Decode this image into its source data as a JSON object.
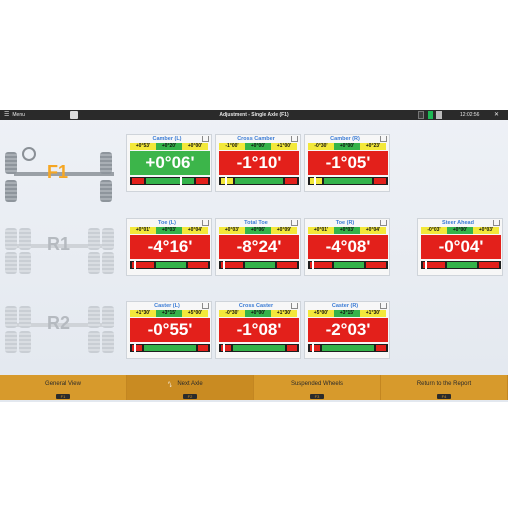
{
  "topbar": {
    "menu_label": "Menu",
    "title": "Adjustment - Single Axle (F1)",
    "time": "12:02:56"
  },
  "axles": {
    "f1": "F1",
    "r1": "R1",
    "r2": "R2"
  },
  "cards": {
    "camber_l": {
      "title": "Camber (L)",
      "tol": [
        "+0°53'",
        "+0°20'",
        "+0°00'"
      ],
      "value": "+0°06'"
    },
    "cross_camber": {
      "title": "Cross Camber",
      "tol": [
        "-1°00'",
        "+0°00'",
        "+1°00'"
      ],
      "value": "-1°10'"
    },
    "camber_r": {
      "title": "Camber (R)",
      "tol": [
        "-0°30'",
        "+0°00'",
        "+0°23'"
      ],
      "value": "-1°05'"
    },
    "toe_l": {
      "title": "Toe (L)",
      "tol": [
        "+0°01'",
        "+0°03'",
        "+0°04'"
      ],
      "value": "-4°16'"
    },
    "total_toe": {
      "title": "Total Toe",
      "tol": [
        "+0°03'",
        "+0°06'",
        "+0°09'"
      ],
      "value": "-8°24'"
    },
    "toe_r": {
      "title": "Toe (R)",
      "tol": [
        "+0°01'",
        "+0°03'",
        "+0°04'"
      ],
      "value": "-4°08'"
    },
    "steer_ahead": {
      "title": "Steer Ahead",
      "tol": [
        "-0°03'",
        "+0°00'",
        "+0°03'"
      ],
      "value": "-0°04'"
    },
    "caster_l": {
      "title": "Caster (L)",
      "tol": [
        "+1°30'",
        "+3°15'",
        "+5°00'"
      ],
      "value": "-0°55'"
    },
    "cross_caster": {
      "title": "Cross Caster",
      "tol": [
        "-0°30'",
        "+0°00'",
        "+1°30'"
      ],
      "value": "-1°08'"
    },
    "caster_r": {
      "title": "Caster (R)",
      "tol": [
        "+5°00'",
        "+3°15'",
        "+1°30'"
      ],
      "value": "-2°03'"
    }
  },
  "fnbar": {
    "b1": {
      "label": "General View",
      "key": "F1"
    },
    "b2": {
      "label": "Next Axle",
      "key": "F2"
    },
    "b3": {
      "label": "Suspended Wheels",
      "key": "F3"
    },
    "b4": {
      "label": "Return to the Report",
      "key": "F4"
    }
  },
  "colors": {
    "out_of_range": "#e3201b",
    "in_range": "#3cb54a",
    "tolerance_yellow": "#f3e83a",
    "function_bar": "#d79a2c",
    "title_blue": "#3a7bd5"
  }
}
